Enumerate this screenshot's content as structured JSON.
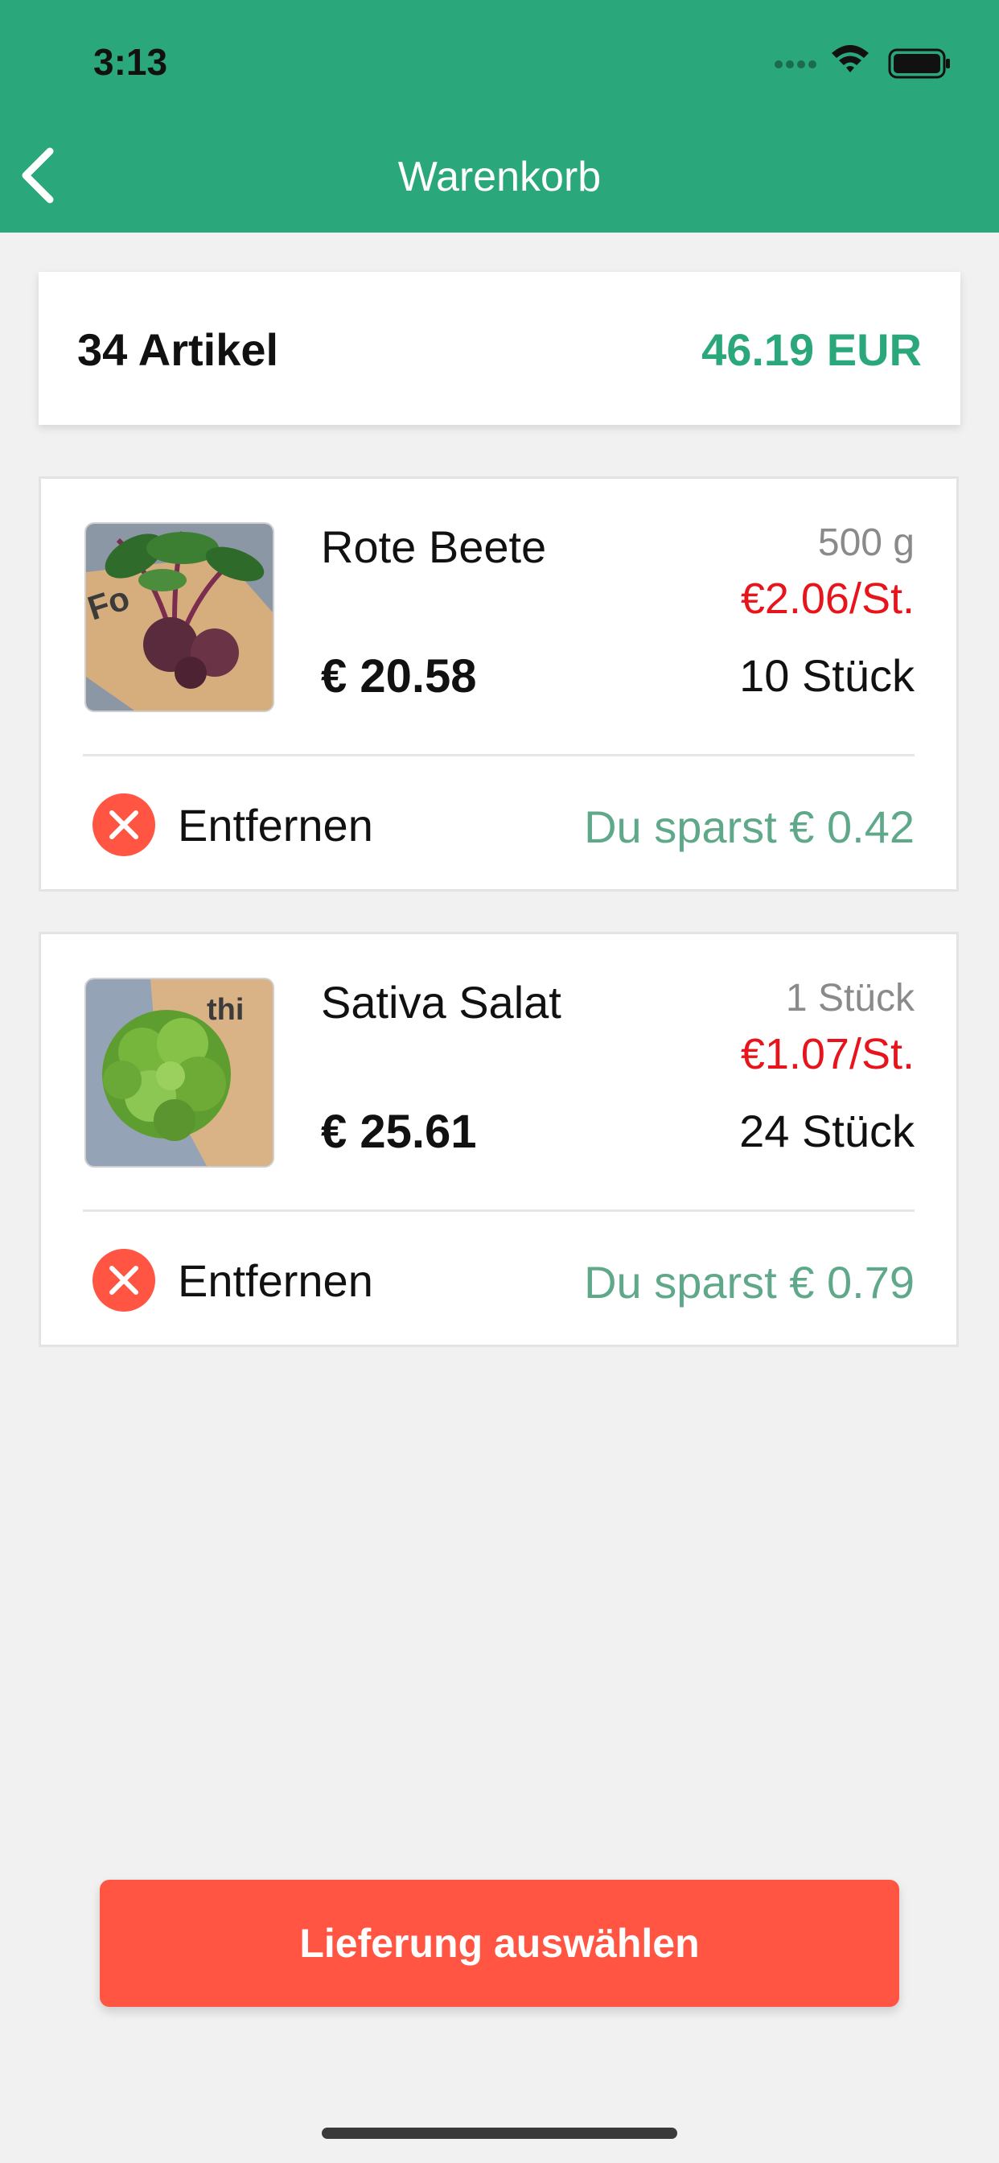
{
  "status_bar": {
    "time": "3:13"
  },
  "nav": {
    "title": "Warenkorb",
    "back_icon": "chevron-left-icon"
  },
  "summary": {
    "count": "34 Artikel",
    "total": "46.19 EUR"
  },
  "items": [
    {
      "name": "Rote Beete",
      "price": "€ 20.58",
      "unit": "500 g",
      "unit_price": "€2.06/St.",
      "quantity": "10 Stück",
      "remove_label": "Entfernen",
      "savings": "Du sparst € 0.42"
    },
    {
      "name": "Sativa Salat",
      "price": "€ 25.61",
      "unit": "1 Stück",
      "unit_price": "€1.07/St.",
      "quantity": "24 Stück",
      "remove_label": "Entfernen",
      "savings": "Du sparst € 0.79"
    }
  ],
  "cta": {
    "label": "Lieferung auswählen"
  },
  "colors": {
    "brand": "#2aa87b",
    "danger": "#ff5542",
    "unit_price": "#e8141b",
    "savings": "#5fa98a"
  }
}
